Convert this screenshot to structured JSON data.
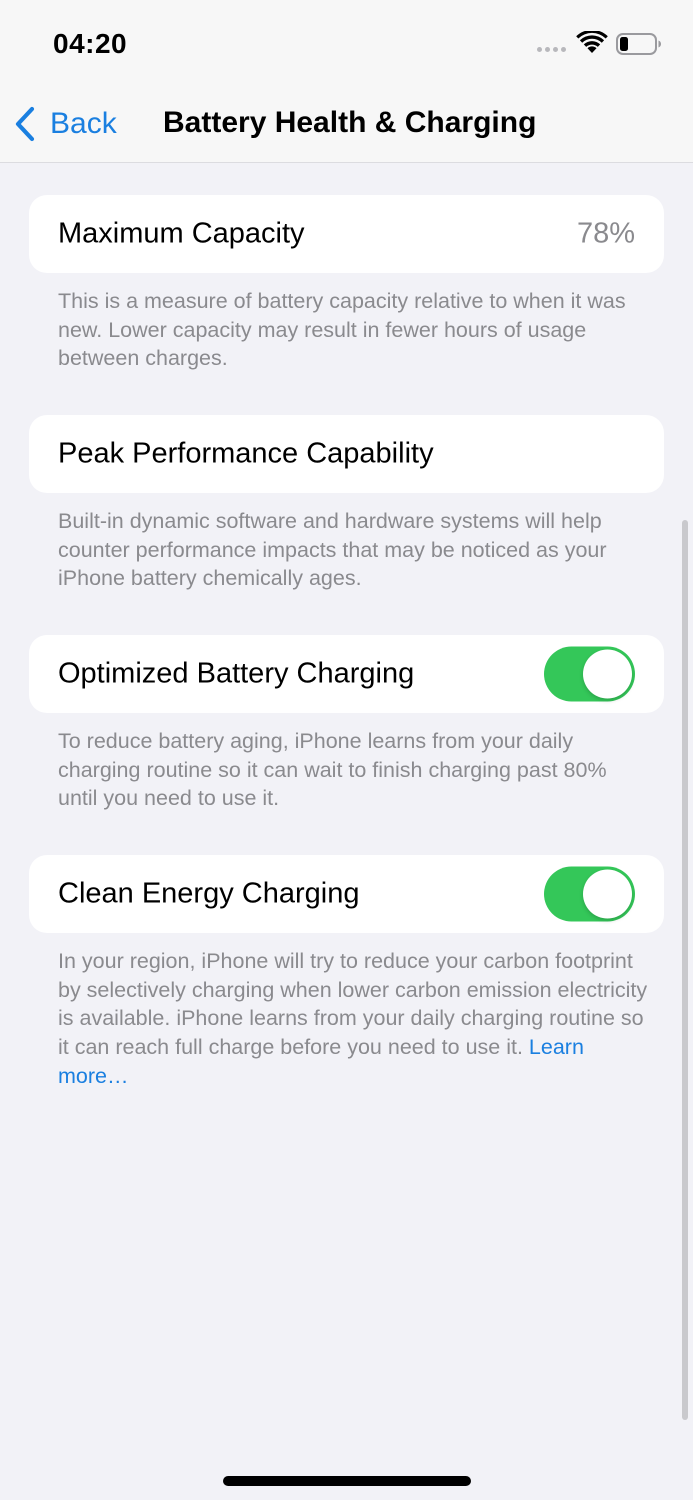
{
  "status_bar": {
    "time": "04:20",
    "icons": [
      "signal-dots-icon",
      "wifi-icon",
      "battery-icon"
    ]
  },
  "nav": {
    "back_label": "Back",
    "title": "Battery Health & Charging"
  },
  "sections": {
    "max_capacity": {
      "label": "Maximum Capacity",
      "value": "78%",
      "footer": "This is a measure of battery capacity relative to when it was new. Lower capacity may result in fewer hours of usage between charges."
    },
    "peak_performance": {
      "label": "Peak Performance Capability",
      "footer": "Built-in dynamic software and hardware systems will help counter performance impacts that may be noticed as your iPhone battery chemically ages."
    },
    "optimized_charging": {
      "label": "Optimized Battery Charging",
      "enabled": true,
      "footer": "To reduce battery aging, iPhone learns from your daily charging routine so it can wait to finish charging past 80% until you need to use it."
    },
    "clean_energy": {
      "label": "Clean Energy Charging",
      "enabled": true,
      "footer": "In your region, iPhone will try to reduce your carbon footprint by selectively charging when lower carbon emission electricity is available. iPhone learns from your daily charging routine so it can reach full charge before you need to use it.",
      "learn_more": "Learn more…"
    }
  },
  "colors": {
    "accent": "#1a7fe0",
    "toggle_on": "#34c759",
    "background": "#f2f2f7",
    "secondary_text": "#8a8a8e"
  }
}
